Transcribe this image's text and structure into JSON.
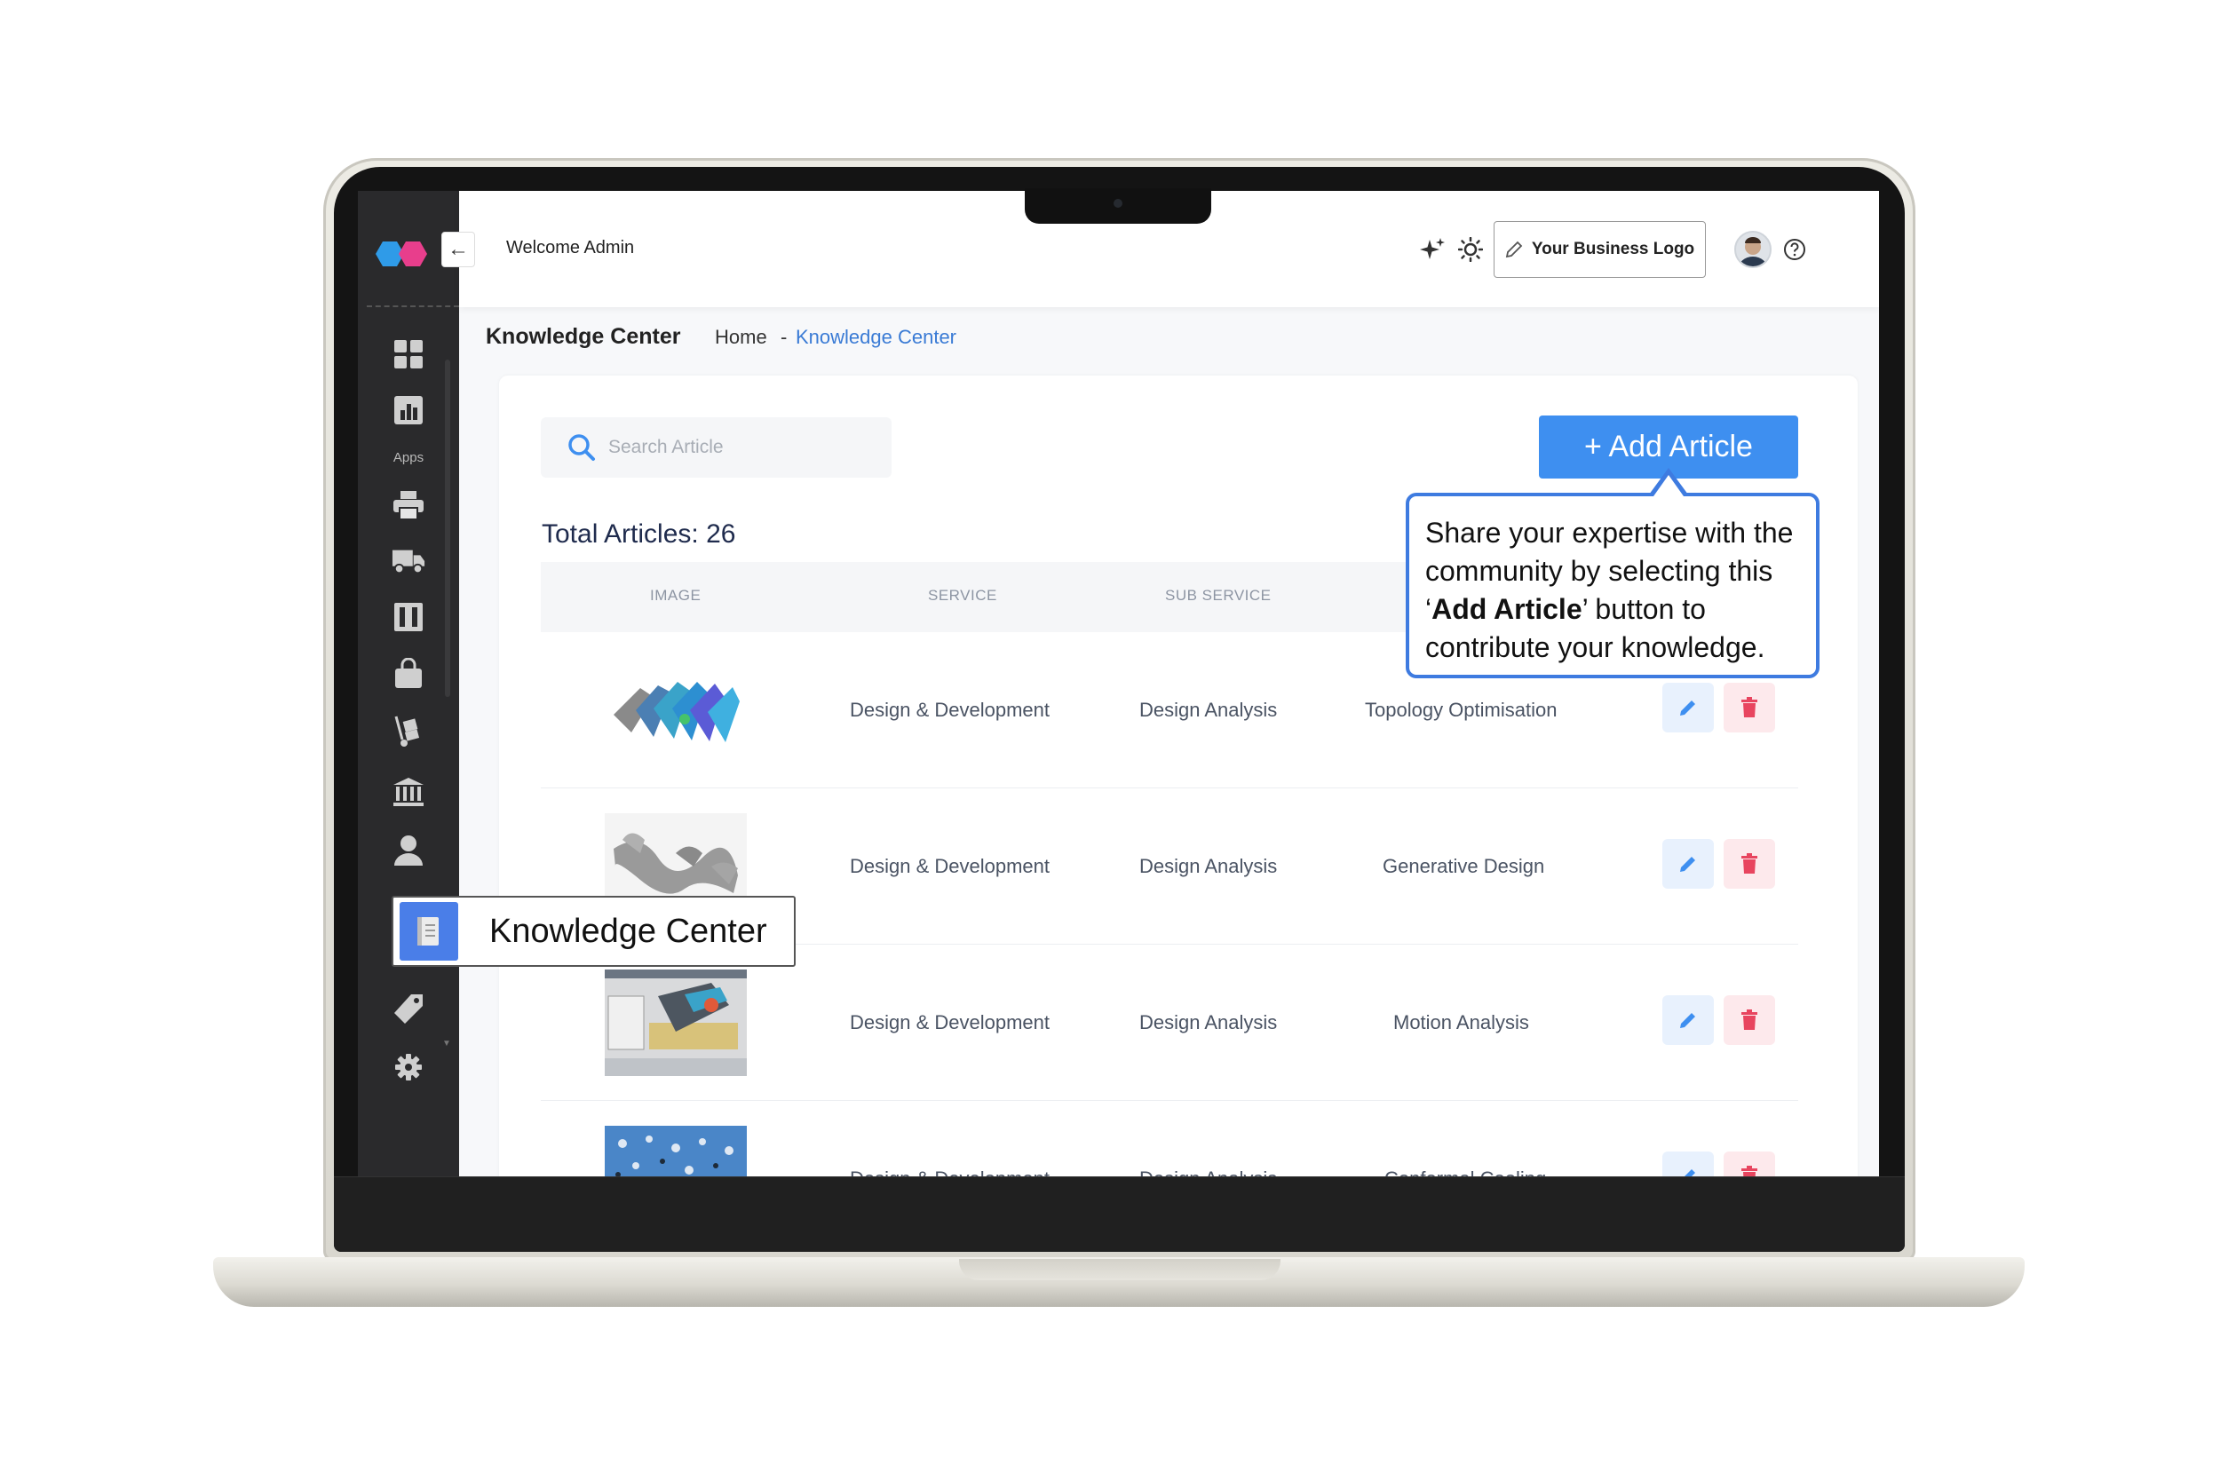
{
  "header": {
    "welcome": "Welcome Admin",
    "business_logo_label": "Your Business Logo"
  },
  "sidebar": {
    "apps_label": "Apps",
    "items": [
      {
        "icon": "dashboard-grid-icon"
      },
      {
        "icon": "bar-chart-icon"
      },
      {
        "icon": "printer-icon"
      },
      {
        "icon": "truck-icon"
      },
      {
        "icon": "columns-icon"
      },
      {
        "icon": "shopping-bag-icon"
      },
      {
        "icon": "hand-truck-icon"
      },
      {
        "icon": "bank-icon"
      },
      {
        "icon": "user-icon"
      },
      {
        "icon": "book-icon",
        "label": "Knowledge Center",
        "active": true
      },
      {
        "icon": "tag-icon"
      },
      {
        "icon": "gear-icon"
      }
    ]
  },
  "breadcrumb": {
    "title": "Knowledge Center",
    "home": "Home",
    "separator": "-",
    "current": "Knowledge Center"
  },
  "search": {
    "placeholder": "Search Article"
  },
  "add_button": {
    "label": "+ Add Article"
  },
  "total_articles": "Total Articles: 26",
  "table": {
    "columns": [
      "IMAGE",
      "SERVICE",
      "SUB SERVICE"
    ],
    "rows": [
      {
        "image": "topology-optimisation-render",
        "service": "Design & Development",
        "sub_service": "Design Analysis",
        "article": "Topology Optimisation"
      },
      {
        "image": "generative-design-render",
        "service": "Design & Development",
        "sub_service": "Design Analysis",
        "article": "Generative Design"
      },
      {
        "image": "motion-analysis-render",
        "service": "Design & Development",
        "sub_service": "Design Analysis",
        "article": "Motion Analysis"
      },
      {
        "image": "conformal-cooling-render",
        "service": "Design & Development",
        "sub_service": "Design Analysis",
        "article": "Conformal Cooling"
      }
    ]
  },
  "tooltip": {
    "pre": "Share your expertise with the community by selecting this ‘",
    "bold": "Add Article",
    "post": "’ button to contribute your knowledge."
  },
  "colors": {
    "accent": "#3e8ff0",
    "sidebar_bg": "#2a2a2c",
    "tooltip_border": "#3e7be0",
    "edit_bg": "#e8f1fd",
    "delete_bg": "#fde9ec",
    "delete_icon": "#e8455f"
  }
}
